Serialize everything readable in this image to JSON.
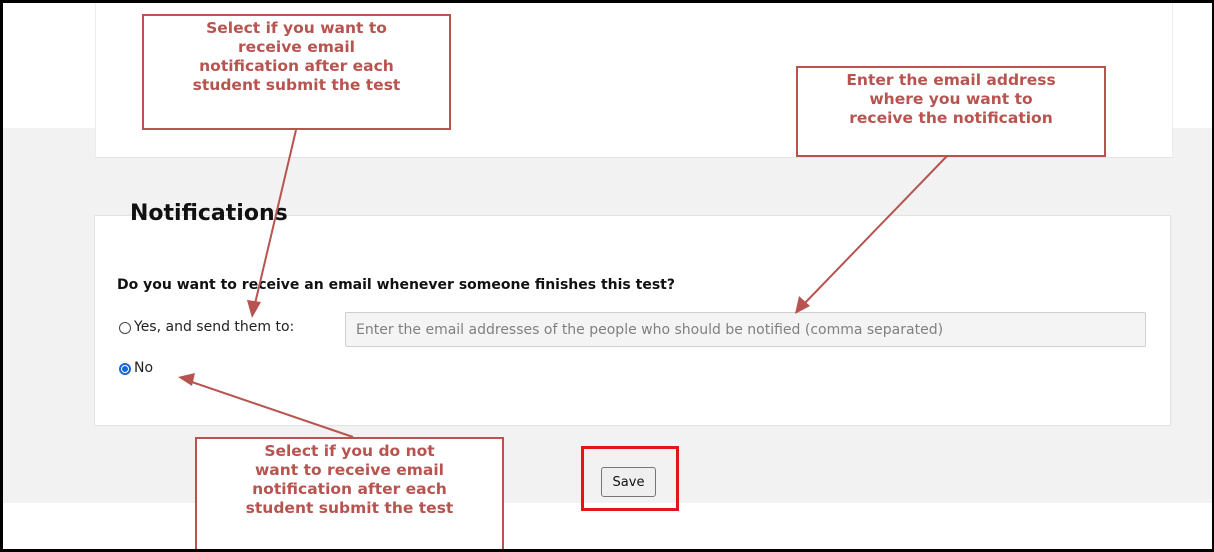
{
  "notifications": {
    "heading": "Notifications",
    "question": "Do you want to receive an email whenever someone finishes this test?",
    "options": [
      {
        "label": "Yes, and send them to:",
        "selected": false
      },
      {
        "label": "No",
        "selected": true
      }
    ],
    "email_input": {
      "value": "",
      "placeholder": "Enter the email addresses of the people who should be notified (comma separated)"
    },
    "save_label": "Save"
  },
  "callouts": {
    "yes_option": [
      "Select if you want to",
      "receive email",
      "notification after each",
      "student submit the test"
    ],
    "email_field": [
      "Enter the email address",
      "where you want to",
      "receive the notification"
    ],
    "no_option": [
      "Select if you do not",
      "want to receive email",
      "notification after each",
      "student submit the test"
    ]
  },
  "colors": {
    "callout": "#b85450",
    "save_highlight": "#e3141a",
    "radio_selected": "#1a66d6",
    "band": "#f2f2f2"
  }
}
